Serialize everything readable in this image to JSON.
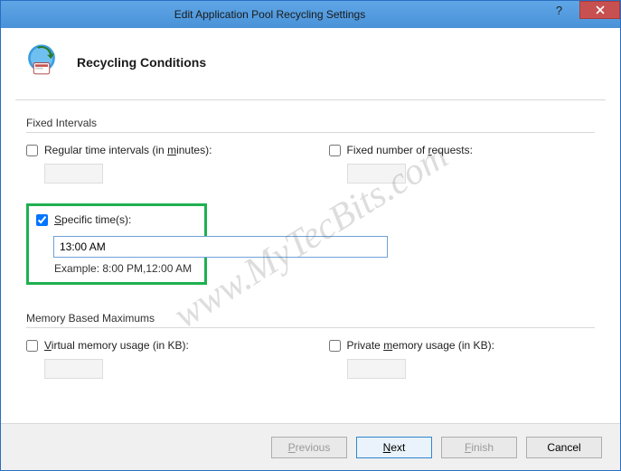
{
  "window": {
    "title": "Edit Application Pool Recycling Settings"
  },
  "header": {
    "title": "Recycling Conditions"
  },
  "groups": {
    "fixed": {
      "title": "Fixed Intervals",
      "regular_label_pre": "Regular time intervals (in ",
      "regular_label_u": "m",
      "regular_label_post": "inutes):",
      "requests_label_pre": "Fixed number of ",
      "requests_label_u": "r",
      "requests_label_post": "equests:"
    },
    "specific": {
      "label_u": "S",
      "label_post": "pecific time(s):",
      "value": "13:00 AM",
      "example": "Example: 8:00 PM,12:00 AM"
    },
    "memory": {
      "title": "Memory Based Maximums",
      "virtual_u": "V",
      "virtual_post": "irtual memory usage (in KB):",
      "private_pre": "Private ",
      "private_u": "m",
      "private_post": "emory usage (in KB):"
    }
  },
  "buttons": {
    "previous_u": "P",
    "previous_post": "revious",
    "next_u": "N",
    "next_post": "ext",
    "finish_u": "F",
    "finish_post": "inish",
    "cancel": "Cancel"
  },
  "watermark": "www.MyTecBits.com"
}
